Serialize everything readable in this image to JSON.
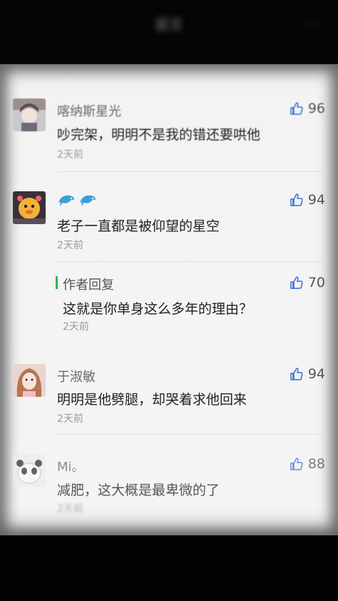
{
  "header": {
    "title": "留言",
    "menu": "···"
  },
  "comments": [
    {
      "name": "喀纳斯星光",
      "text": "吵完架，明明不是我的错还要哄他",
      "time": "2天前",
      "likes": "96"
    },
    {
      "name_icon": "dolphin-emoji",
      "text": "老子一直都是被仰望的星空",
      "time": "2天前",
      "likes": "94",
      "reply": {
        "label": "作者回复",
        "text": "这就是你单身这么多年的理由？",
        "time": "2天前",
        "likes": "70"
      }
    },
    {
      "name": "于淑敏",
      "text": "明明是他劈腿，却哭着求他回来",
      "time": "2天前",
      "likes": "94"
    },
    {
      "name": "Mi。",
      "text": "减肥，这大概是最卑微的了",
      "time": "2天前",
      "likes": "88"
    }
  ],
  "colors": {
    "reply_accent": "#2db84c",
    "like_icon": "#2f6fd8"
  }
}
